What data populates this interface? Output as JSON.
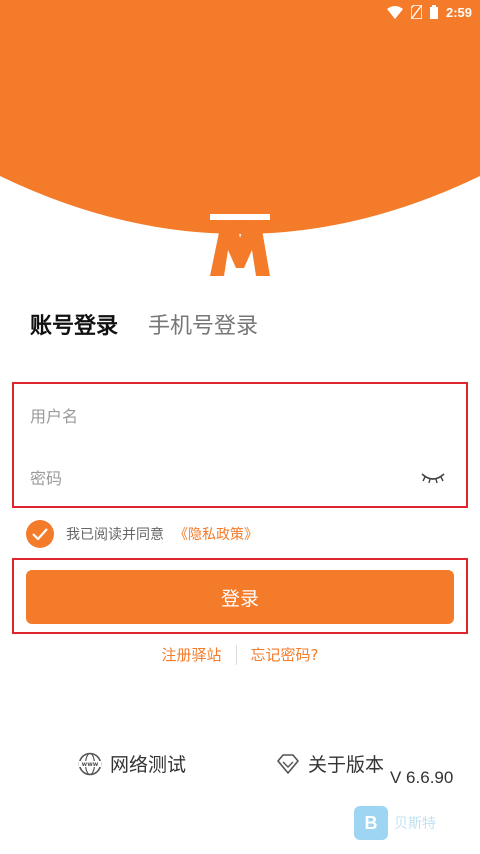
{
  "status_bar": {
    "time": "2:59",
    "icons": [
      "wifi-icon",
      "no-sim-icon",
      "battery-icon"
    ]
  },
  "colors": {
    "accent": "#f47b2a",
    "highlight_box": "#e0242e",
    "text_dark": "#111111",
    "text_muted": "#777777"
  },
  "logo": {
    "icon": "app-logo-m",
    "text": "M"
  },
  "tabs": [
    {
      "label": "账号登录",
      "active": true
    },
    {
      "label": "手机号登录",
      "active": false
    }
  ],
  "form": {
    "username_placeholder": "用户名",
    "username_value": "",
    "password_placeholder": "密码",
    "password_value": "",
    "password_toggle_icon": "eye-closed-icon"
  },
  "agreement": {
    "checked": true,
    "text": "我已阅读并同意",
    "policy_link": "《隐私政策》"
  },
  "login_button": {
    "label": "登录"
  },
  "links": {
    "register": "注册驿站",
    "forgot_password": "忘记密码?"
  },
  "bottom": {
    "network_test": {
      "label": "网络测试",
      "icon": "www-globe-icon"
    },
    "about_version": {
      "label": "关于版本",
      "icon": "diamond-icon"
    },
    "version": "V 6.6.90"
  },
  "watermark": {
    "letter": "B",
    "text": "贝斯特"
  }
}
